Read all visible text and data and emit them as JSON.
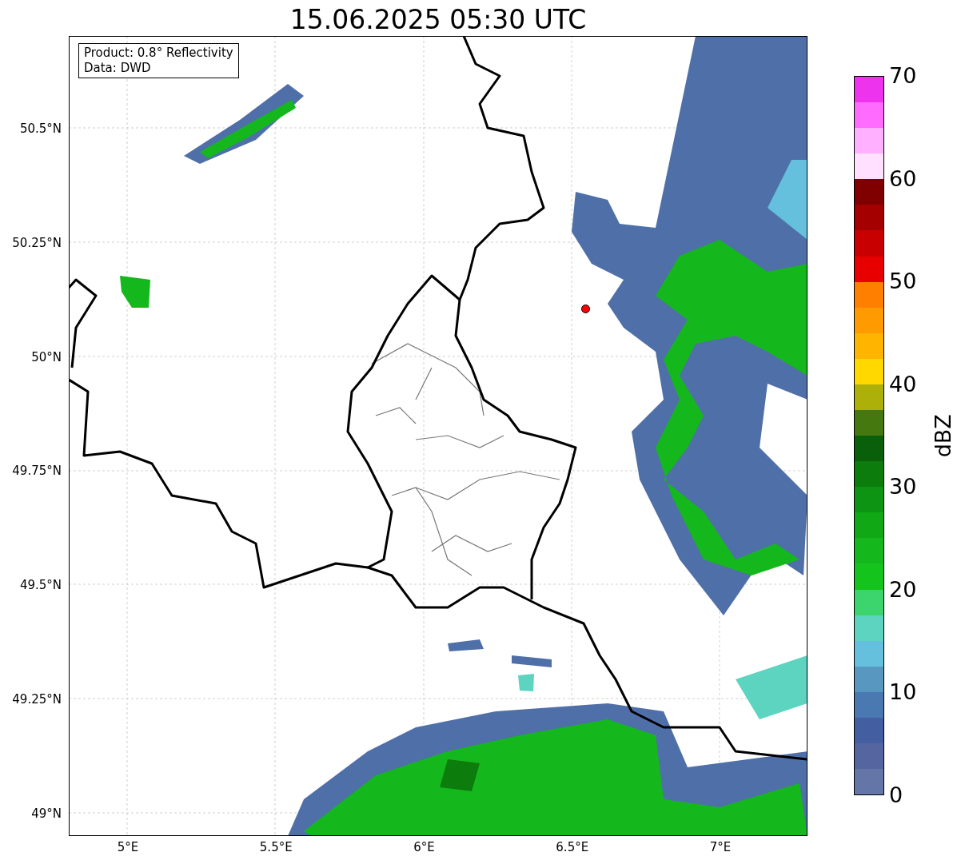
{
  "title": "15.06.2025 05:30 UTC",
  "info_box": [
    "Product: 0.8° Reflectivity",
    "Data: DWD"
  ],
  "x_ticks": [
    "5°E",
    "5.5°E",
    "6°E",
    "6.5°E",
    "7°E"
  ],
  "y_ticks": [
    "50.5°N",
    "50.25°N",
    "50°N",
    "49.75°N",
    "49.5°N",
    "49.25°N",
    "49°N"
  ],
  "colorbar": {
    "label": "dBZ",
    "ticks": [
      "70",
      "60",
      "50",
      "40",
      "30",
      "20",
      "10",
      "0"
    ],
    "levels": [
      {
        "color": "#ee33ee"
      },
      {
        "color": "#ff6aff"
      },
      {
        "color": "#ffb0ff"
      },
      {
        "color": "#ffe0ff"
      },
      {
        "color": "#800000"
      },
      {
        "color": "#a40000"
      },
      {
        "color": "#c80000"
      },
      {
        "color": "#e80000"
      },
      {
        "color": "#ff8000"
      },
      {
        "color": "#ff9a00"
      },
      {
        "color": "#ffb400"
      },
      {
        "color": "#ffd800"
      },
      {
        "color": "#acb008"
      },
      {
        "color": "#467810"
      },
      {
        "color": "#0a600a"
      },
      {
        "color": "#0c7c0c"
      },
      {
        "color": "#0c9412"
      },
      {
        "color": "#10a814"
      },
      {
        "color": "#14b81c"
      },
      {
        "color": "#14c41c"
      },
      {
        "color": "#3cd46c"
      },
      {
        "color": "#5cd4c0"
      },
      {
        "color": "#64c0dc"
      },
      {
        "color": "#5898c0"
      },
      {
        "color": "#4a78b0"
      },
      {
        "color": "#445ea2"
      },
      {
        "color": "#5465a0"
      },
      {
        "color": "#6475a8"
      }
    ]
  }
}
